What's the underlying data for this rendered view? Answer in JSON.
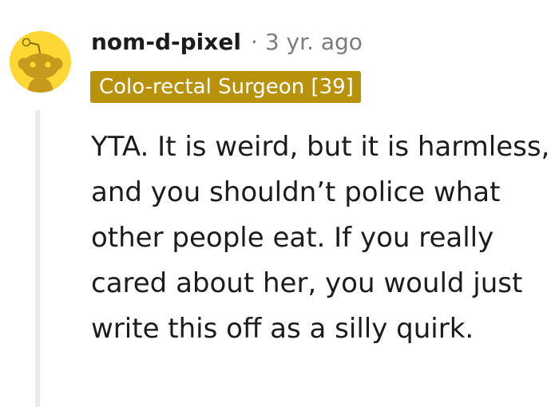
{
  "comment": {
    "username": "nom-d-pixel",
    "separator": "·",
    "timestamp": "3 yr. ago",
    "flair": "Colo-rectal Surgeon [39]",
    "body": "YTA. It is weird, but it is harmless, and you shouldn’t police what other people eat. If you really cared about her, you would just write this off as a silly quirk.",
    "avatar_icon": "snoo-avatar-icon"
  },
  "colors": {
    "avatar_bg": "#fdd835",
    "flair_bg": "#b9920b",
    "text": "#1c1c1c",
    "meta": "#7c7c7c"
  }
}
